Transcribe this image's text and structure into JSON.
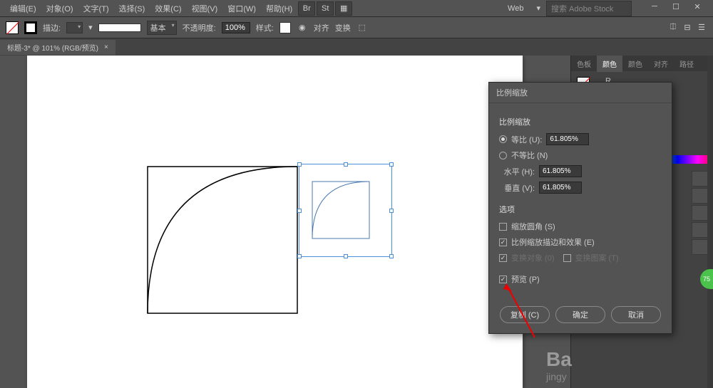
{
  "menu": {
    "items": [
      "编辑(E)",
      "对象(O)",
      "文字(T)",
      "选择(S)",
      "效果(C)",
      "视图(V)",
      "窗口(W)",
      "帮助(H)"
    ],
    "web": "Web",
    "search_placeholder": "搜索 Adobe Stock"
  },
  "toolbar": {
    "stroke_label": "描边:",
    "stroke_style": "基本",
    "opacity_label": "不透明度:",
    "opacity_value": "100%",
    "style_label": "样式:",
    "align": "对齐",
    "transform": "变换"
  },
  "tab": {
    "title": "标题-3* @ 101% (RGB/预览)"
  },
  "panels": {
    "tabs": [
      "色板",
      "颜色",
      "颜色",
      "对齐",
      "路径"
    ],
    "r": "R"
  },
  "dialog": {
    "title": "比例缩放",
    "scale_group": "比例缩放",
    "uniform": "等比 (U):",
    "nonuniform": "不等比 (N)",
    "horizontal": "水平 (H):",
    "vertical": "垂直 (V):",
    "value": "61.805%",
    "options": "选项",
    "scale_corners": "缩放圆角 (S)",
    "scale_strokes": "比例缩放描边和效果 (E)",
    "transform_obj": "变换对象 (0)",
    "transform_pat": "变换图案 (T)",
    "preview": "预览 (P)",
    "copy": "复制 (C)",
    "ok": "确定",
    "cancel": "取消"
  },
  "watermark": {
    "ba": "Ba",
    "jingy": "jingy"
  }
}
